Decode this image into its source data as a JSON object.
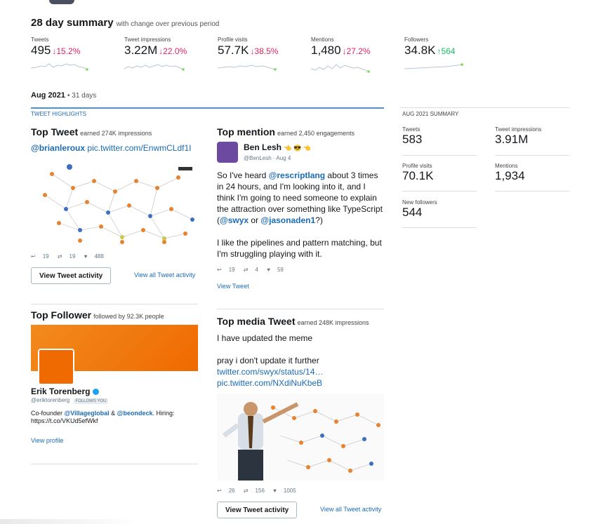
{
  "summary": {
    "title": "28 day summary",
    "subtitle": "with change over previous period",
    "stats": [
      {
        "label": "Tweets",
        "value": "495",
        "change": "↓15.2%"
      },
      {
        "label": "Tweet impressions",
        "value": "3.22M",
        "change": "↓22.0%"
      },
      {
        "label": "Profile visits",
        "value": "57.7K",
        "change": "↓38.5%"
      },
      {
        "label": "Mentions",
        "value": "1,480",
        "change": "↓27.2%"
      },
      {
        "label": "Followers",
        "value": "34.8K",
        "change": "↑564"
      }
    ]
  },
  "month": {
    "label": "Aug 2021",
    "days": "• 31 days"
  },
  "highlights": {
    "label": "TWEET HIGHLIGHTS"
  },
  "top_tweet": {
    "title": "Top Tweet",
    "subtitle": "earned 274K impressions",
    "mention": "@brianleroux",
    "link": "pic.twitter.com/EnwmCLdf1I",
    "replies": "19",
    "retweets": "19",
    "likes": "488",
    "button": "View Tweet activity",
    "all_link": "View all Tweet activity"
  },
  "top_mention": {
    "title": "Top mention",
    "subtitle": "earned 2,450 engagements",
    "name": "Ben Lesh",
    "emoji": "👈 😎 👈",
    "handle": "@BenLesh · Aug 4",
    "text1_a": "So I've heard ",
    "text1_mention": "@rescriptlang",
    "text1_b": " about 3 times in 24 hours, and I'm looking into it, and I think I'm going to need someone to explain the attraction over something like TypeScript (",
    "text1_m2": "@swyx",
    "text1_or": " or ",
    "text1_m3": "@jasonaden1",
    "text1_end": "?)",
    "text2": "I like the pipelines and pattern matching, but I'm struggling playing with it.",
    "replies": "19",
    "retweets": "4",
    "likes": "59",
    "view_link": "View Tweet"
  },
  "top_follower": {
    "title": "Top Follower",
    "subtitle": "followed by 92.3K people",
    "name": "Erik Torenberg",
    "handle": "@eriktorenberg",
    "follows_badge": "FOLLOWS YOU",
    "bio_a": "Co-founder ",
    "bio_m1": "@Villageglobal",
    "bio_amp": " & ",
    "bio_m2": "@beondeck",
    "bio_b": ". Hiring: https://t.co/VKUd5efWkf",
    "view_profile": "View profile"
  },
  "top_media": {
    "title": "Top media Tweet",
    "subtitle": "earned 248K impressions",
    "line1": "I have updated the meme",
    "line2": "pray i don't update it further",
    "link1": "twitter.com/swyx/status/14…",
    "link2": "pic.twitter.com/NXdiNuKbeB",
    "replies": "26",
    "retweets": "156",
    "likes": "1005",
    "button": "View Tweet activity",
    "all_link": "View all Tweet activity"
  },
  "aug_summary": {
    "label": "AUG 2021 SUMMARY",
    "items": [
      {
        "label": "Tweets",
        "value": "583"
      },
      {
        "label": "Tweet impressions",
        "value": "3.91M"
      },
      {
        "label": "Profile visits",
        "value": "70.1K"
      },
      {
        "label": "Mentions",
        "value": "1,934"
      },
      {
        "label": "New followers",
        "value": "544"
      }
    ]
  },
  "colors": {
    "accent": "#1b6bb5",
    "down": "#e0245e",
    "up": "#17bf63",
    "banner": "#f07a10"
  },
  "icons": [
    "reply-icon",
    "retweet-icon",
    "heart-icon",
    "verified-icon"
  ]
}
